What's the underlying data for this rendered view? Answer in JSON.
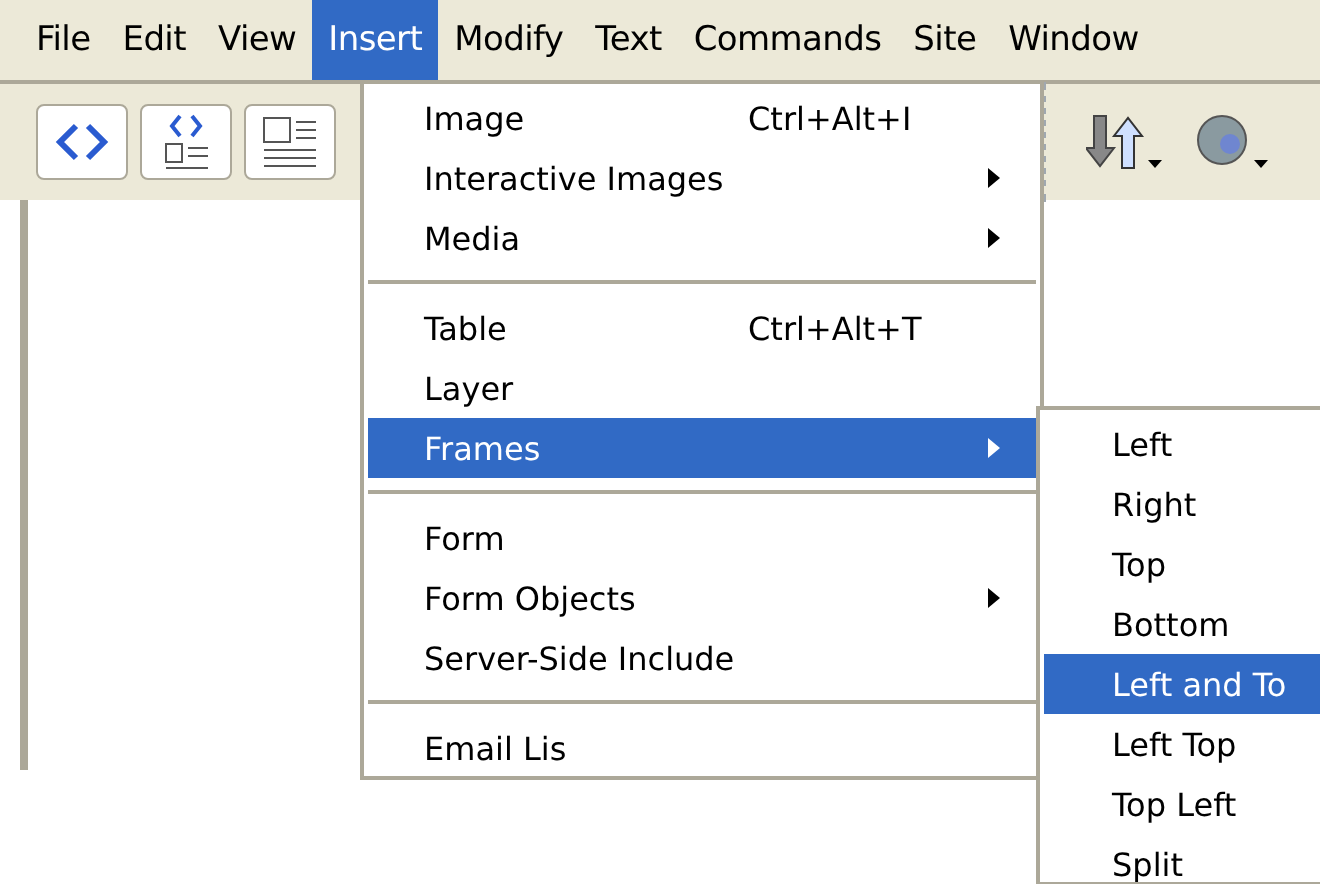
{
  "menubar": [
    {
      "label": "File",
      "selected": false
    },
    {
      "label": "Edit",
      "selected": false
    },
    {
      "label": "View",
      "selected": false
    },
    {
      "label": "Insert",
      "selected": true
    },
    {
      "label": "Modify",
      "selected": false
    },
    {
      "label": "Text",
      "selected": false
    },
    {
      "label": "Commands",
      "selected": false
    },
    {
      "label": "Site",
      "selected": false
    },
    {
      "label": "Window",
      "selected": false
    }
  ],
  "insert_menu": [
    {
      "kind": "item",
      "label": "Image",
      "shortcut": "Ctrl+Alt+I",
      "has_submenu": false,
      "selected": false
    },
    {
      "kind": "item",
      "label": "Interactive Images",
      "has_submenu": true,
      "selected": false
    },
    {
      "kind": "item",
      "label": "Media",
      "has_submenu": true,
      "selected": false
    },
    {
      "kind": "separator"
    },
    {
      "kind": "item",
      "label": "Table",
      "shortcut": "Ctrl+Alt+T",
      "has_submenu": false,
      "selected": false
    },
    {
      "kind": "item",
      "label": "Layer",
      "has_submenu": false,
      "selected": false
    },
    {
      "kind": "item",
      "label": "Frames",
      "has_submenu": true,
      "selected": true
    },
    {
      "kind": "separator"
    },
    {
      "kind": "item",
      "label": "Form",
      "has_submenu": false,
      "selected": false
    },
    {
      "kind": "item",
      "label": "Form Objects",
      "has_submenu": true,
      "selected": false
    },
    {
      "kind": "item",
      "label": "Server-Side Include",
      "has_submenu": false,
      "selected": false
    },
    {
      "kind": "separator"
    },
    {
      "kind": "item",
      "label": "Email Lis",
      "has_submenu": false,
      "selected": false
    }
  ],
  "frames_submenu": [
    {
      "label": "Left",
      "selected": false
    },
    {
      "label": "Right",
      "selected": false
    },
    {
      "label": "Top",
      "selected": false
    },
    {
      "label": "Bottom",
      "selected": false
    },
    {
      "label": "Left and To",
      "selected": true
    },
    {
      "label": "Left Top",
      "selected": false
    },
    {
      "label": "Top Left",
      "selected": false
    },
    {
      "label": "Split",
      "selected": false
    }
  ]
}
